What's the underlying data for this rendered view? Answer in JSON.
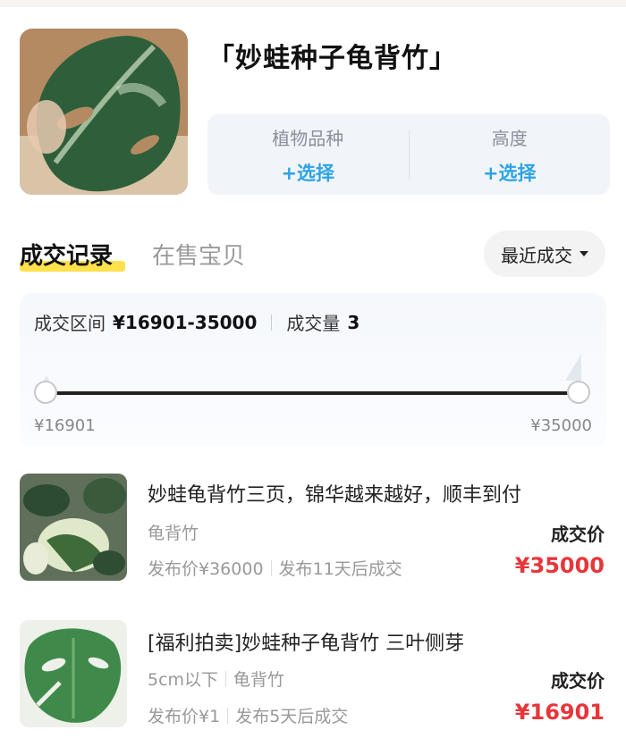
{
  "header": {
    "title": "「妙蛙种子龟背竹」",
    "attributes": [
      {
        "label": "植物品种",
        "action": "+选择"
      },
      {
        "label": "高度",
        "action": "+选择"
      }
    ]
  },
  "tabs": {
    "active": "成交记录",
    "inactive": "在售宝贝",
    "sort": "最近成交"
  },
  "range": {
    "label": "成交区间",
    "value": "¥16901-35000",
    "volume_label": "成交量",
    "volume": "3",
    "min": "¥16901",
    "max": "¥35000"
  },
  "listings": [
    {
      "title": "妙蛙龟背竹三页，锦华越来越好，顺丰到付",
      "tags": [
        "龟背竹"
      ],
      "published": "发布价¥36000",
      "sold_after": "发布11天后成交",
      "deal_label": "成交价",
      "deal_price": "¥35000"
    },
    {
      "title": "[福利拍卖]妙蛙种子龟背竹 三叶侧芽",
      "tags": [
        "5cm以下",
        "龟背竹"
      ],
      "published": "发布价¥1",
      "sold_after": "发布5天后成交",
      "deal_label": "成交价",
      "deal_price": "¥16901"
    }
  ],
  "colors": {
    "accent_blue": "#2da3e6",
    "price_red": "#e8353a",
    "tab_underline": "#ffe14d"
  }
}
